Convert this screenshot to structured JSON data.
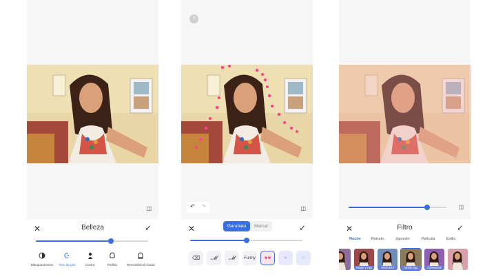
{
  "screen1": {
    "title": "Belleza",
    "slider_level": 0.67,
    "tools": [
      {
        "label": "Blanqueamiento",
        "icon": "whitening-icon",
        "active": false
      },
      {
        "label": "Tono de piel",
        "icon": "skin-tone-icon",
        "active": true
      },
      {
        "label": "Contor.",
        "icon": "contour-icon",
        "active": false
      },
      {
        "label": "Perfilar",
        "icon": "profile-icon",
        "active": false
      },
      {
        "label": "Remodelación facial",
        "icon": "face-reshape-icon",
        "active": false
      }
    ]
  },
  "screen2": {
    "help_label": "?",
    "tabs": [
      "Garabato",
      "Marcar"
    ],
    "active_tab": "Garabato",
    "slider_level": 0.5,
    "brushes": [
      {
        "label": "",
        "icon": "eraser-icon"
      },
      {
        "label": "",
        "icon": "brush-m-icon"
      },
      {
        "label": "",
        "icon": "brush-m2-icon"
      },
      {
        "label": "Funny",
        "icon": "funny-brush-icon"
      },
      {
        "label": "",
        "icon": "hearts-brush-icon",
        "selected": true
      },
      {
        "label": "",
        "icon": "sparkle-brush-icon"
      },
      {
        "label": "",
        "icon": "sparkle2-brush-icon"
      }
    ]
  },
  "screen3": {
    "title": "Filtro",
    "slider_level": 0.8,
    "categories": [
      "Noche",
      "Retrato",
      "Japonés",
      "Película",
      "Estilo"
    ],
    "active_category": "Noche",
    "thumbs": [
      {
        "label": "",
        "tint": "#8c6d9c"
      },
      {
        "label": "Negro y rojo",
        "tint": "#9a4a4a"
      },
      {
        "label": "Hielo azul",
        "tint": "#6e8db8"
      },
      {
        "label": "Verde rojo",
        "tint": "#8c7b5a",
        "selected": true
      },
      {
        "label": "Cyberpunk",
        "tint": "#8e5fb0"
      },
      {
        "label": "",
        "tint": "#d8a0a8"
      },
      {
        "label": "",
        "tint": "#caa08a"
      }
    ]
  },
  "icons": {
    "close": "✕",
    "confirm": "✓",
    "compare": "◫",
    "undo": "↶",
    "redo": "↷"
  },
  "colors": {
    "accent": "#3a6fe0",
    "panel_bg": "#ffffff",
    "canvas_bg": "#f6f6f6"
  }
}
